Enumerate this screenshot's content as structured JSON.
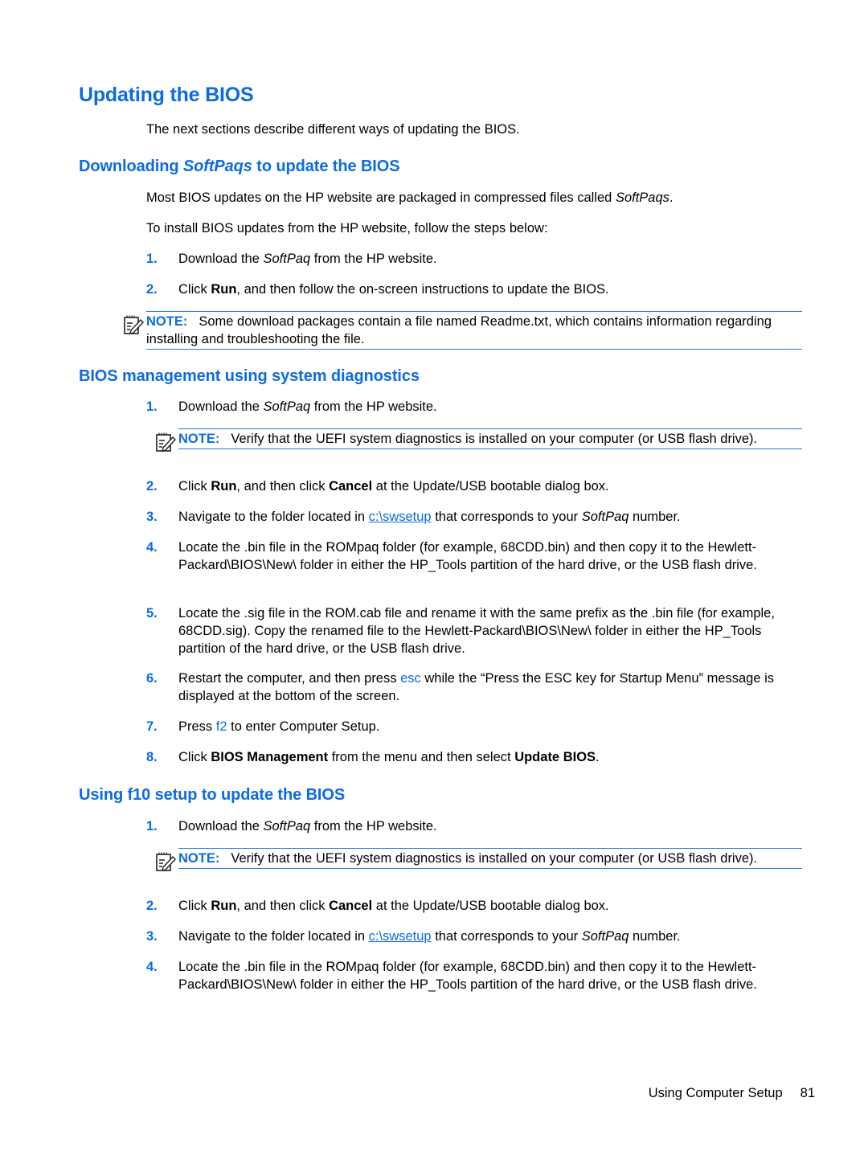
{
  "document": {
    "title": "Updating the BIOS",
    "intro": "The next sections describe different ways of updating the BIOS.",
    "accent_color": "#0d6be0"
  },
  "section1": {
    "heading_pre": "Downloading ",
    "heading_em": "SoftPaqs",
    "heading_post": " to update the BIOS",
    "para1_pre": "Most BIOS updates on the HP website are packaged in compressed files called ",
    "para1_em": "SoftPaqs",
    "para1_post": ".",
    "para2": "To install BIOS updates from the HP website, follow the steps below:",
    "steps": [
      {
        "num": "1.",
        "pre": "Download the ",
        "em": "SoftPaq",
        "post": " from the HP website."
      },
      {
        "num": "2.",
        "pre": "Click ",
        "bold": "Run",
        "post": ", and then follow the on-screen instructions to update the BIOS."
      }
    ],
    "note": {
      "label": "NOTE:",
      "text": "Some download packages contain a file named Readme.txt, which contains information regarding installing and troubleshooting the file."
    }
  },
  "section2": {
    "heading": "BIOS management using system diagnostics",
    "step1": {
      "num": "1.",
      "pre": "Download the ",
      "em": "SoftPaq",
      "post": " from the HP website."
    },
    "note": {
      "label": "NOTE:",
      "text": "Verify that the UEFI system diagnostics is installed on your computer (or USB flash drive)."
    },
    "step2": {
      "num": "2.",
      "pre": "Click ",
      "bold1": "Run",
      "mid": ", and then click ",
      "bold2": "Cancel",
      "post": " at the Update/USB bootable dialog box."
    },
    "step3": {
      "num": "3.",
      "pre": "Navigate to the folder located in ",
      "link": "c:\\swsetup",
      "mid": " that corresponds to your ",
      "em": "SoftPaq",
      "post": " number."
    },
    "step4": {
      "num": "4.",
      "text": "Locate the .bin file in the ROMpaq folder (for example, 68CDD.bin) and then copy it to the Hewlett-Packard\\BIOS\\New\\ folder in either the HP_Tools partition of the hard drive, or the USB flash drive."
    },
    "step5": {
      "num": "5.",
      "text": "Locate the .sig file in the ROM.cab file and rename it with the same prefix as the .bin file (for example, 68CDD.sig). Copy the renamed file to the Hewlett-Packard\\BIOS\\New\\ folder in either the HP_Tools partition of the hard drive, or the USB flash drive."
    },
    "step6": {
      "num": "6.",
      "pre": "Restart the computer, and then press ",
      "key": "esc",
      "post": " while the “Press the ESC key for Startup Menu” message is displayed at the bottom of the screen."
    },
    "step7": {
      "num": "7.",
      "pre": "Press ",
      "key": "f2",
      "post": " to enter Computer Setup."
    },
    "step8": {
      "num": "8.",
      "pre": "Click ",
      "bold1": "BIOS Management",
      "mid": " from the menu and then select ",
      "bold2": "Update BIOS",
      "post": "."
    }
  },
  "section3": {
    "heading": "Using f10 setup to update the BIOS",
    "step1": {
      "num": "1.",
      "pre": "Download the ",
      "em": "SoftPaq",
      "post": " from the HP website."
    },
    "note": {
      "label": "NOTE:",
      "text": "Verify that the UEFI system diagnostics is installed on your computer (or USB flash drive)."
    },
    "step2": {
      "num": "2.",
      "pre": "Click ",
      "bold1": "Run",
      "mid": ", and then click ",
      "bold2": "Cancel",
      "post": " at the Update/USB bootable dialog box."
    },
    "step3": {
      "num": "3.",
      "pre": "Navigate to the folder located in ",
      "link": "c:\\swsetup",
      "mid": " that corresponds to your ",
      "em": "SoftPaq",
      "post": " number."
    },
    "step4": {
      "num": "4.",
      "text": "Locate the .bin file in the ROMpaq folder (for example, 68CDD.bin) and then copy it to the Hewlett-Packard\\BIOS\\New\\ folder in either the HP_Tools partition of the hard drive, or the USB flash drive."
    }
  },
  "footer": {
    "chapter": "Using Computer Setup",
    "page": "81"
  }
}
